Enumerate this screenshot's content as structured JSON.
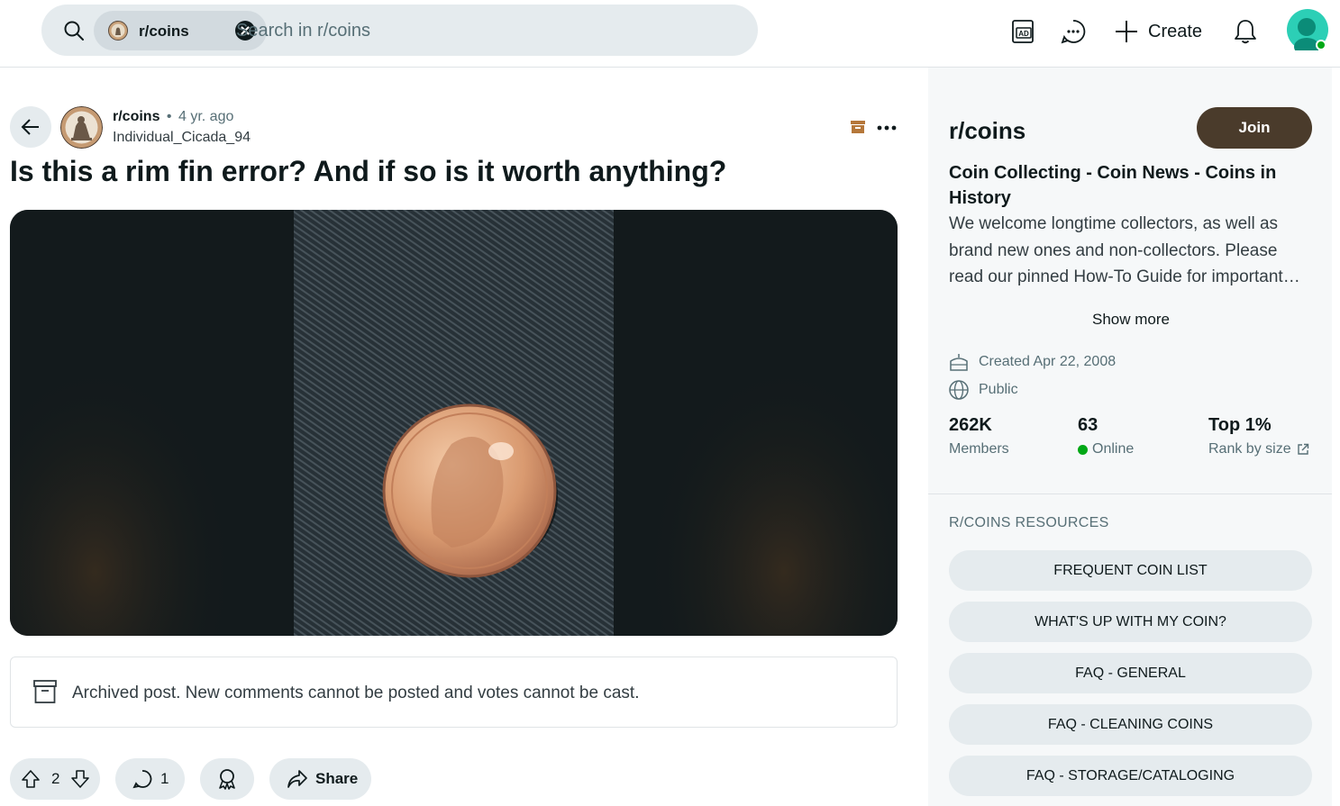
{
  "header": {
    "search_placeholder": "Search in r/coins",
    "chip_label": "r/coins",
    "ads_icon": "ad-icon",
    "chat_icon": "chat-bubble-icon",
    "create_label": "Create",
    "notification_icon": "bell-icon"
  },
  "post": {
    "subreddit": "r/coins",
    "separator": "•",
    "age": "4 yr. ago",
    "author": "Individual_Cicada_94",
    "title": "Is this a rim fin error? And if so is it worth anything?",
    "archived_notice": "Archived post. New comments cannot be posted and votes cannot be cast.",
    "votes": "2",
    "comments": "1",
    "share_label": "Share"
  },
  "sidebar": {
    "title": "r/coins",
    "join_label": "Join",
    "heading": "Coin Collecting - Coin News - Coins in History",
    "description": "We welcome longtime collectors, as well as brand new ones and non-collectors. Please read our pinned How-To Guide for important information.",
    "show_more": "Show more",
    "created": "Created Apr 22, 2008",
    "visibility": "Public",
    "stats": {
      "members_value": "262K",
      "members_label": "Members",
      "online_value": "63",
      "online_label": "Online",
      "rank_value": "Top 1%",
      "rank_label": "Rank by size"
    },
    "resources_title": "R/COINS RESOURCES",
    "resources": [
      "FREQUENT COIN LIST",
      "WHAT'S UP WITH MY COIN?",
      "FAQ - GENERAL",
      "FAQ - CLEANING COINS",
      "FAQ - STORAGE/CATALOGING"
    ]
  },
  "colors": {
    "join_button": "#4a3b2b",
    "online": "#01a816",
    "chip_bg": "#d2dadf",
    "pill_bg": "#e5ebee",
    "avatar": "#2ccfb6"
  }
}
